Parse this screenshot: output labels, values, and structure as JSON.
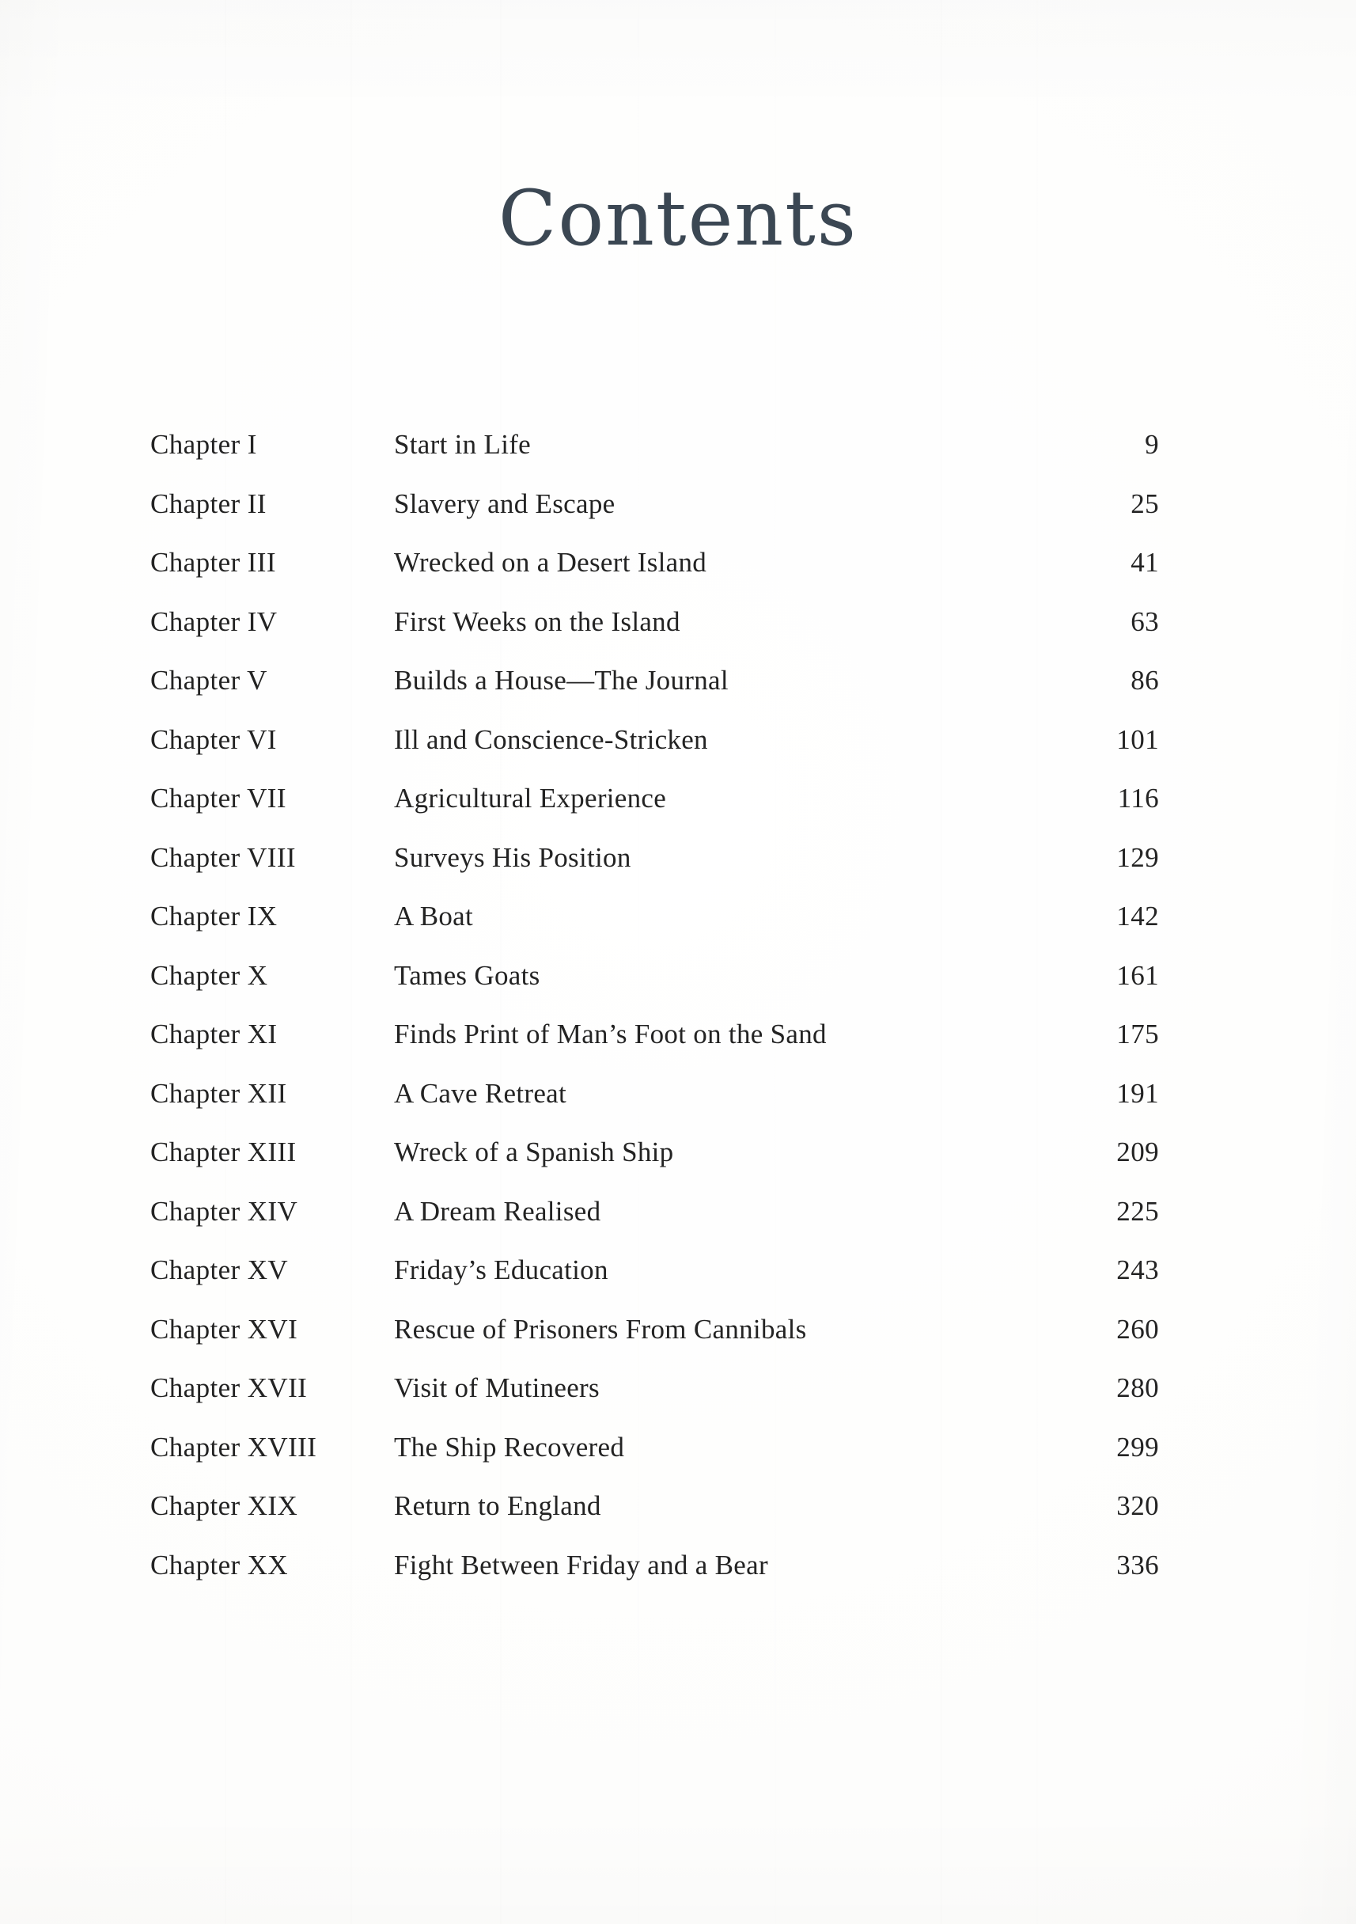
{
  "document": {
    "heading": "Contents",
    "heading_color": "#3b4753",
    "body_text_color": "#232323",
    "page_background": "#ffffff"
  },
  "contents": {
    "entries": [
      {
        "chapter": "Chapter I",
        "title": "Start in Life",
        "page": "9"
      },
      {
        "chapter": "Chapter II",
        "title": "Slavery and Escape",
        "page": "25"
      },
      {
        "chapter": "Chapter III",
        "title": "Wrecked on a Desert Island",
        "page": "41"
      },
      {
        "chapter": "Chapter IV",
        "title": "First Weeks on the Island",
        "page": "63"
      },
      {
        "chapter": "Chapter V",
        "title": "Builds a House—The Journal",
        "page": "86"
      },
      {
        "chapter": "Chapter VI",
        "title": "Ill and Conscience-Stricken",
        "page": "101"
      },
      {
        "chapter": "Chapter VII",
        "title": "Agricultural Experience",
        "page": "116"
      },
      {
        "chapter": "Chapter VIII",
        "title": "Surveys His Position",
        "page": "129"
      },
      {
        "chapter": "Chapter IX",
        "title": "A Boat",
        "page": "142"
      },
      {
        "chapter": "Chapter X",
        "title": "Tames Goats",
        "page": "161"
      },
      {
        "chapter": "Chapter XI",
        "title": "Finds Print of Man’s Foot on the Sand",
        "page": "175"
      },
      {
        "chapter": "Chapter XII",
        "title": "A Cave Retreat",
        "page": "191"
      },
      {
        "chapter": "Chapter XIII",
        "title": "Wreck of a Spanish Ship",
        "page": "209"
      },
      {
        "chapter": "Chapter XIV",
        "title": "A Dream Realised",
        "page": "225"
      },
      {
        "chapter": "Chapter XV",
        "title": "Friday’s Education",
        "page": "243"
      },
      {
        "chapter": "Chapter XVI",
        "title": "Rescue of Prisoners From Cannibals",
        "page": "260"
      },
      {
        "chapter": "Chapter XVII",
        "title": "Visit of Mutineers",
        "page": "280"
      },
      {
        "chapter": "Chapter XVIII",
        "title": "The Ship Recovered",
        "page": "299"
      },
      {
        "chapter": "Chapter XIX",
        "title": "Return to England",
        "page": "320"
      },
      {
        "chapter": "Chapter XX",
        "title": "Fight Between Friday and a Bear",
        "page": "336"
      }
    ]
  }
}
